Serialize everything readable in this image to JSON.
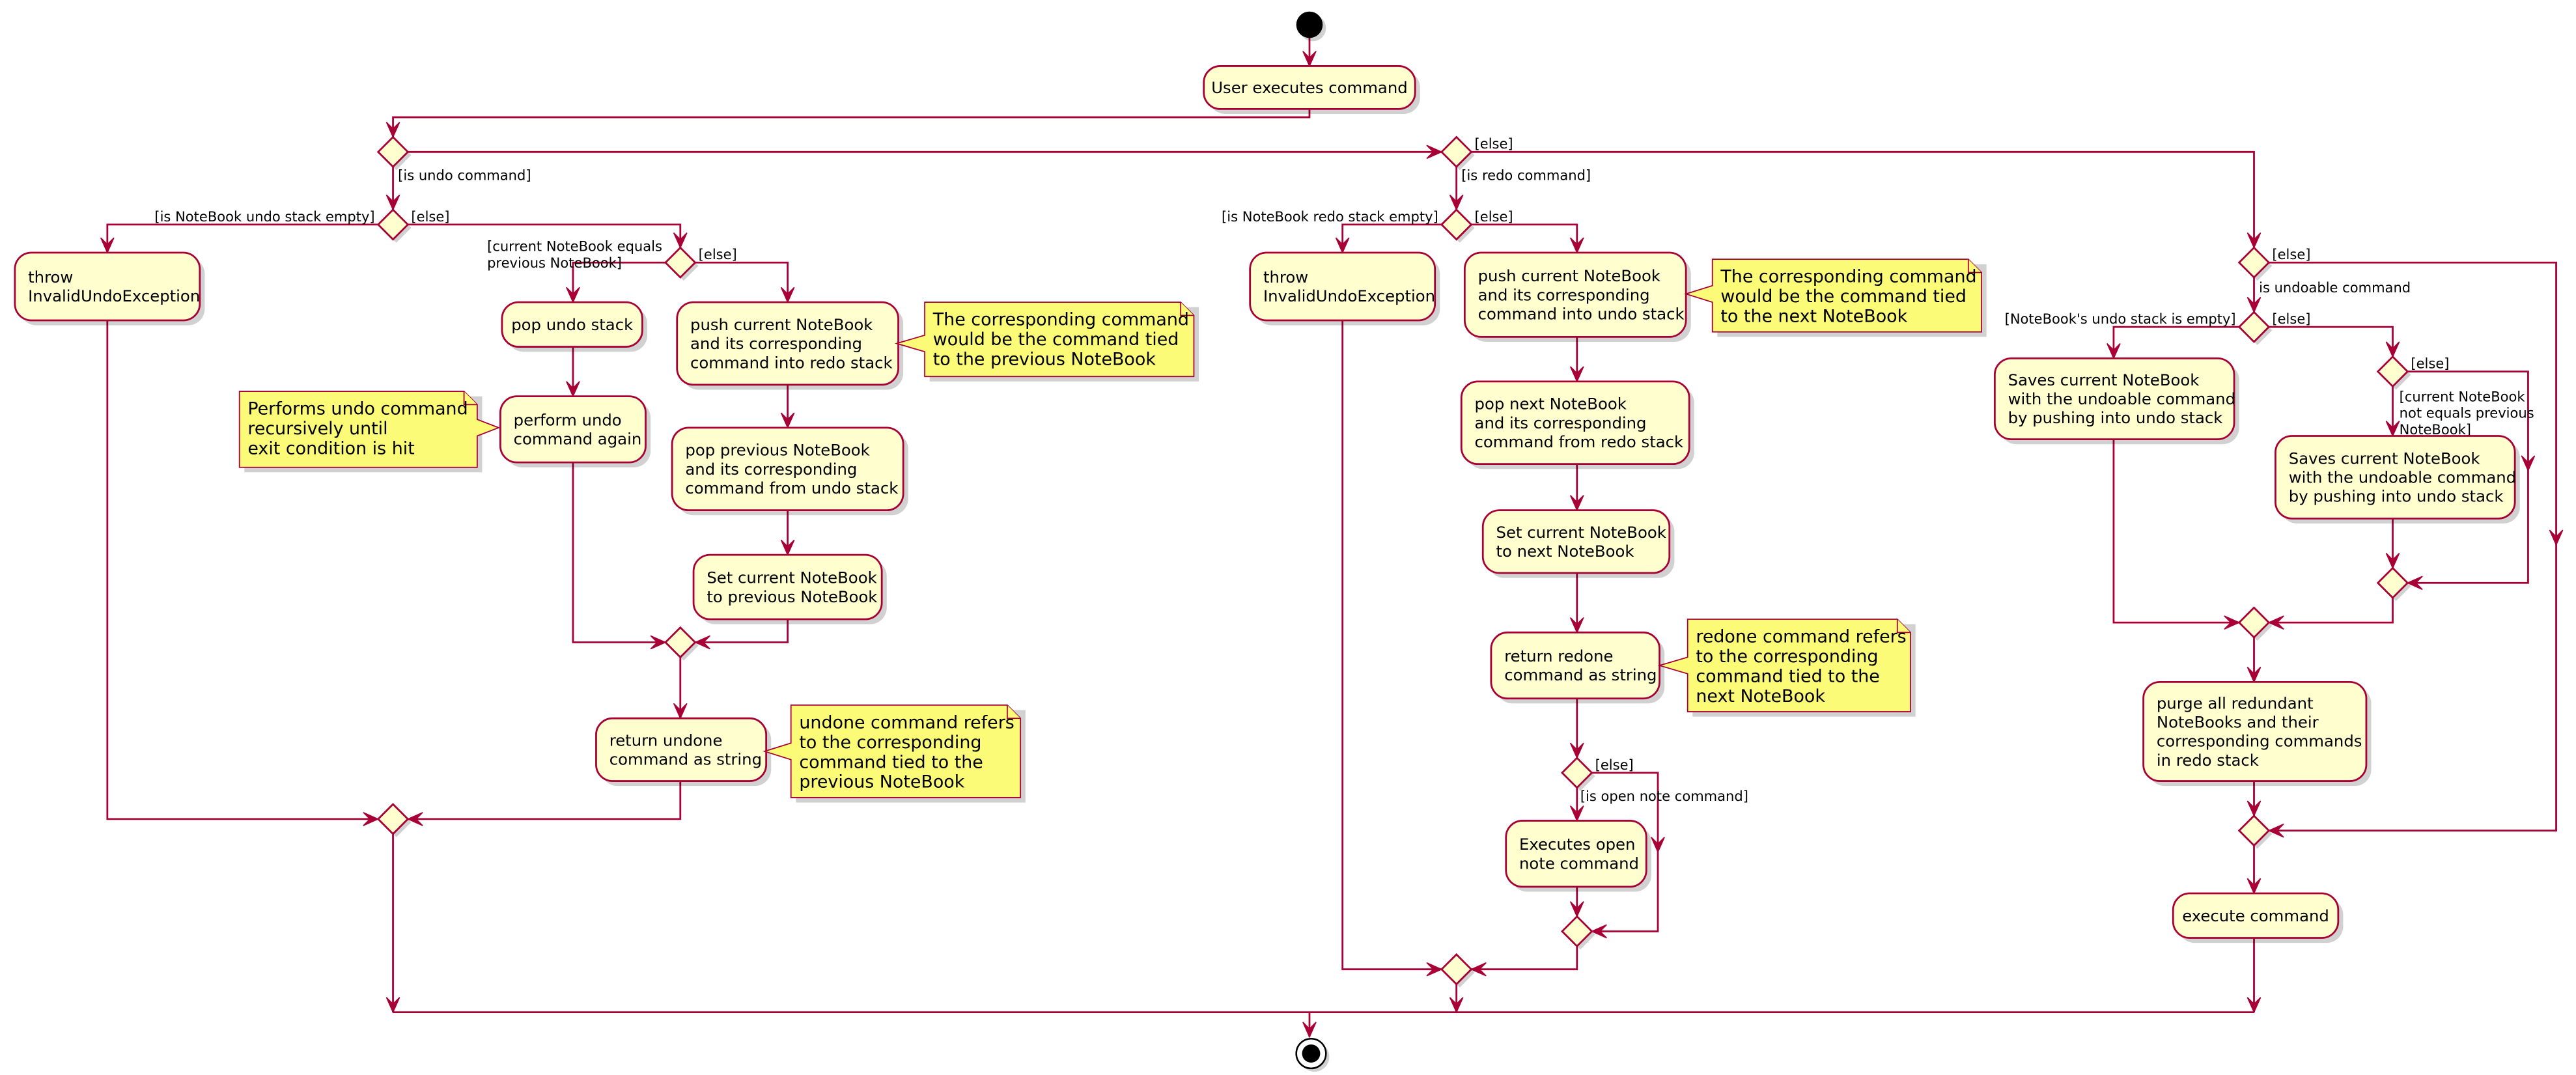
{
  "diagram": {
    "type": "uml-activity",
    "colors": {
      "line": "#A80036",
      "action_fill": "#FEFECE",
      "note_fill": "#FBFB77",
      "start": "#000000"
    },
    "start_label": "start",
    "end_label": "end",
    "actions": {
      "user_executes": [
        "User executes command"
      ],
      "throw_undo": [
        "throw",
        "InvalidUndoException"
      ],
      "pop_undo_stack": [
        "pop undo stack"
      ],
      "perform_undo_again": [
        "perform undo",
        "command again"
      ],
      "push_into_redo": [
        "push current NoteBook",
        "and its corresponding",
        "command into redo stack"
      ],
      "pop_previous": [
        "pop previous NoteBook",
        "and its corresponding",
        "command from undo stack"
      ],
      "set_previous": [
        "Set current NoteBook",
        "to previous NoteBook"
      ],
      "return_undone": [
        "return undone",
        "command as string"
      ],
      "throw_redo": [
        "throw",
        "InvalidUndoException"
      ],
      "push_into_undo": [
        "push current NoteBook",
        "and its corresponding",
        "command into undo stack"
      ],
      "pop_next": [
        "pop next NoteBook",
        "and its corresponding",
        "command from redo stack"
      ],
      "set_next": [
        "Set current NoteBook",
        "to next NoteBook"
      ],
      "return_redone": [
        "return redone",
        "command as string"
      ],
      "execute_open_note": [
        "Executes open",
        "note command"
      ],
      "save_empty": [
        "Saves current NoteBook",
        "with the undoable command",
        "by pushing into undo stack"
      ],
      "save_not_equal": [
        "Saves current NoteBook",
        "with the undoable command",
        "by pushing into undo stack"
      ],
      "purge_redo": [
        "purge all redundant",
        "NoteBooks and their",
        "corresponding commands",
        "in redo stack"
      ],
      "execute_command": [
        "execute command"
      ]
    },
    "notes": {
      "recursive_undo": [
        "Performs undo command",
        "recursively until",
        "exit condition is hit"
      ],
      "undo_tied_previous": [
        "The corresponding command",
        "would be the command tied",
        "to the previous NoteBook"
      ],
      "undone_refers": [
        "undone command refers",
        "to the corresponding",
        "command tied to the",
        "previous NoteBook"
      ],
      "redo_tied_next": [
        "The corresponding command",
        "would be the command tied",
        "to the next NoteBook"
      ],
      "redone_refers": [
        "redone command refers",
        "to the corresponding",
        "command tied to the",
        "next NoteBook"
      ]
    },
    "guards": {
      "is_undo": [
        "[is undo command]"
      ],
      "else_top": [
        "[else]"
      ],
      "undo_empty": [
        "[is NoteBook undo stack empty]"
      ],
      "undo_empty_else": [
        "[else]"
      ],
      "current_equals_prev": [
        "[current NoteBook equals",
        " previous NoteBook]"
      ],
      "current_equals_else": [
        "[else]"
      ],
      "is_redo": [
        "[is redo command]"
      ],
      "redo_empty": [
        "[is NoteBook redo stack empty]"
      ],
      "redo_empty_else": [
        "[else]"
      ],
      "open_note": [
        "[is open note command]"
      ],
      "open_note_else": [
        "[else]"
      ],
      "undoable_else": [
        "[else]"
      ],
      "is_undoable": [
        "is undoable command"
      ],
      "nb_undo_empty": [
        "[NoteBook's undo stack is empty]"
      ],
      "nb_undo_empty_else": [
        "[else]"
      ],
      "not_equal_prev": [
        "[current NoteBook",
        "not equals previous",
        "NoteBook]"
      ],
      "not_equal_else": [
        "[else]"
      ]
    }
  }
}
